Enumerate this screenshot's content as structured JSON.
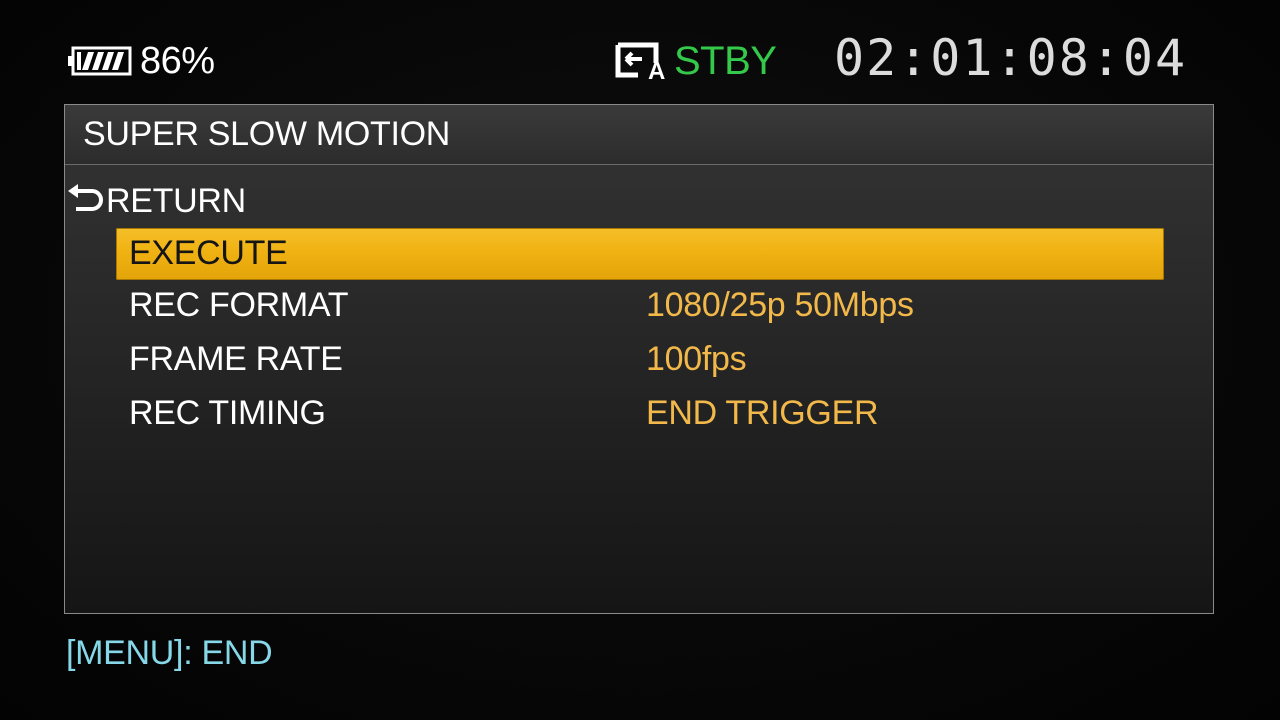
{
  "status_bar": {
    "battery_icon": "battery-icon",
    "battery_percent": "86%",
    "media_icon": "memory-card-slot-a-icon",
    "rec_status": "STBY",
    "rec_status_color": "#34c94a",
    "timecode": "02:01:08:04"
  },
  "menu": {
    "title": "SUPER SLOW MOTION",
    "return_icon": "return-arrow-icon",
    "return_label": "RETURN",
    "highlight_color": "#f0b212",
    "value_color": "#f2b94a",
    "items": [
      {
        "label": "EXECUTE",
        "value": "",
        "selected": true
      },
      {
        "label": "REC FORMAT",
        "value": "1080/25p 50Mbps",
        "selected": false
      },
      {
        "label": "FRAME RATE",
        "value": "100fps",
        "selected": false
      },
      {
        "label": "REC TIMING",
        "value": "END TRIGGER",
        "selected": false
      }
    ]
  },
  "footer": {
    "hint": "[MENU]: END",
    "hint_color": "#86d7e8"
  }
}
